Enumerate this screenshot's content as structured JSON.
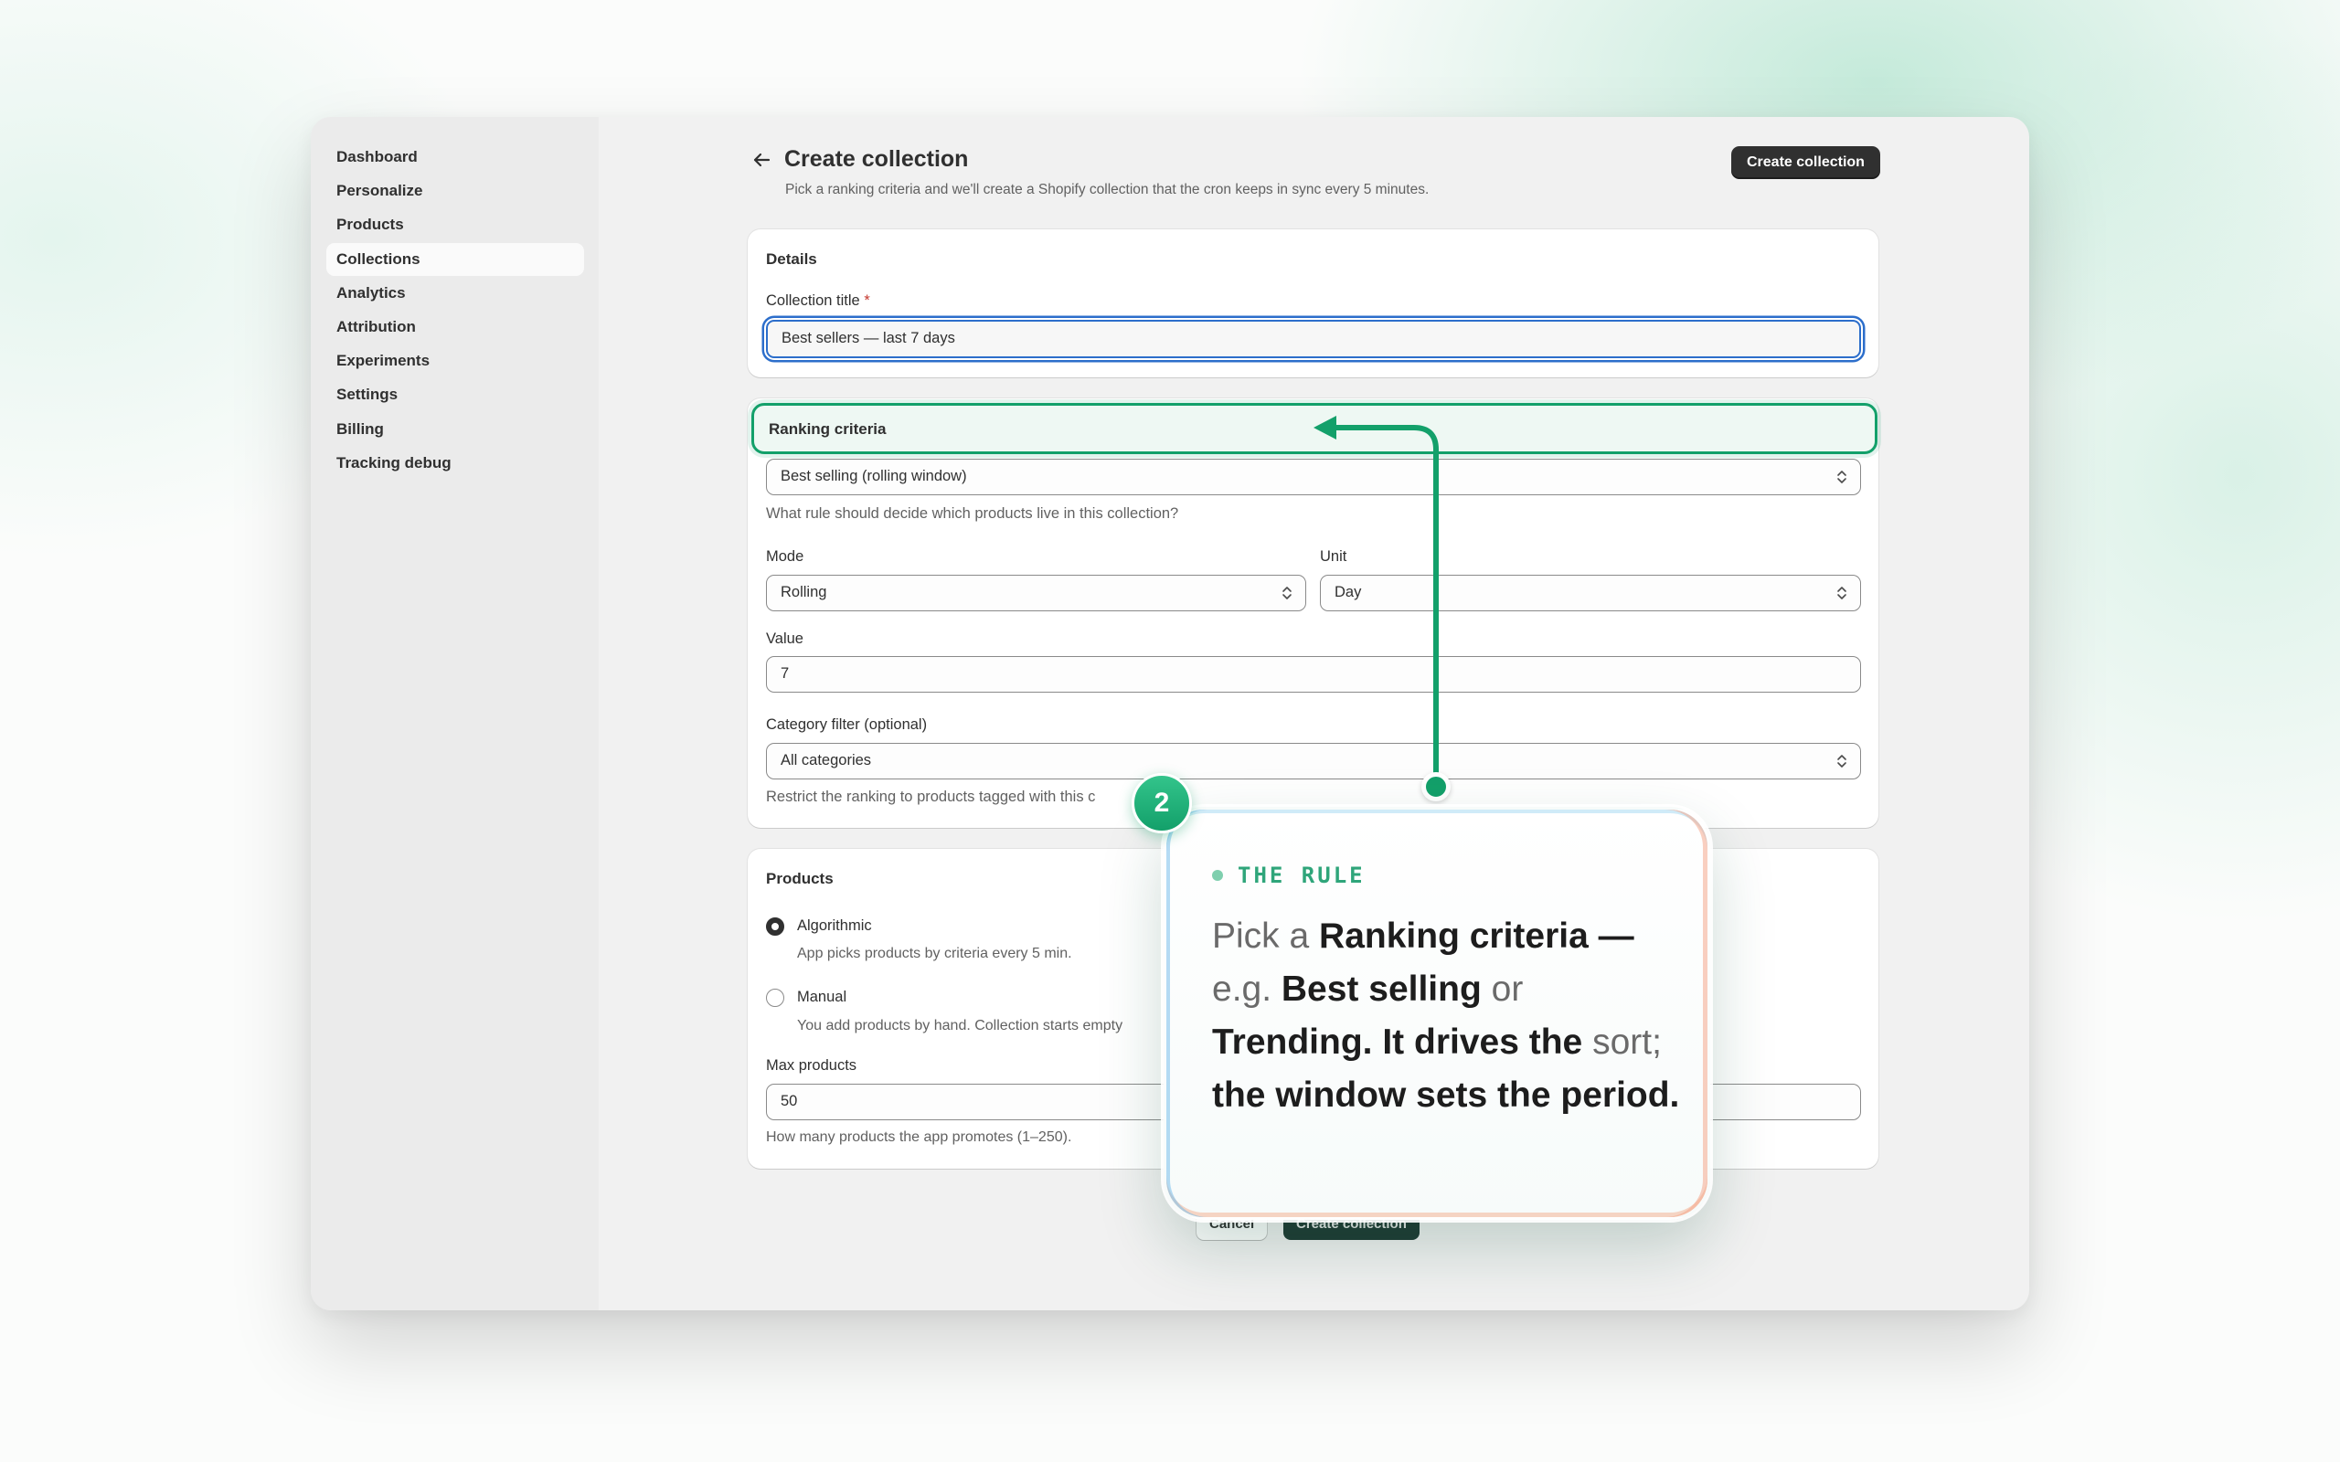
{
  "sidebar": {
    "items": [
      {
        "label": "Dashboard"
      },
      {
        "label": "Personalize"
      },
      {
        "label": "Products"
      },
      {
        "label": "Collections",
        "active": true
      },
      {
        "label": "Analytics"
      },
      {
        "label": "Attribution"
      },
      {
        "label": "Experiments"
      },
      {
        "label": "Settings"
      },
      {
        "label": "Billing"
      },
      {
        "label": "Tracking debug"
      }
    ]
  },
  "header": {
    "title": "Create collection",
    "subtitle": "Pick a ranking criteria and we'll create a Shopify collection that the cron keeps in sync every 5 minutes.",
    "primary_button": "Create collection"
  },
  "details": {
    "title": "Details",
    "collection_title_label": "Collection title",
    "required_mark": "*",
    "collection_title_value": "Best sellers — last 7 days"
  },
  "ranking": {
    "title": "Ranking criteria",
    "criteria_value": "Best selling (rolling window)",
    "criteria_help": "What rule should decide which products live in this collection?",
    "mode_label": "Mode",
    "mode_value": "Rolling",
    "unit_label": "Unit",
    "unit_value": "Day",
    "value_label": "Value",
    "value_value": "7",
    "category_label": "Category filter (optional)",
    "category_value": "All categories",
    "category_help": "Restrict the ranking to products tagged with this c"
  },
  "products": {
    "title": "Products",
    "options": [
      {
        "label": "Algorithmic",
        "help": "App picks products by criteria every 5 min.",
        "checked": true
      },
      {
        "label": "Manual",
        "help": "You add products by hand. Collection starts empty",
        "checked": false
      }
    ],
    "max_label": "Max products",
    "max_value": "50",
    "max_help": "How many products the app promotes (1–250)."
  },
  "footer": {
    "cancel": "Cancel",
    "create": "Create collection"
  },
  "tour": {
    "step": "2",
    "kicker": "THE RULE",
    "body_pre": "Pick a ",
    "body_bold1": "Ranking criteria —",
    "body_mid1": " e.g. ",
    "body_bold2": "Best selling",
    "body_mid2": " or ",
    "body_bold3": "Trending. It drives the",
    "body_mid3": " sort; ",
    "body_bold4": "the window sets the period.",
    "accent_color": "#13a06a"
  }
}
